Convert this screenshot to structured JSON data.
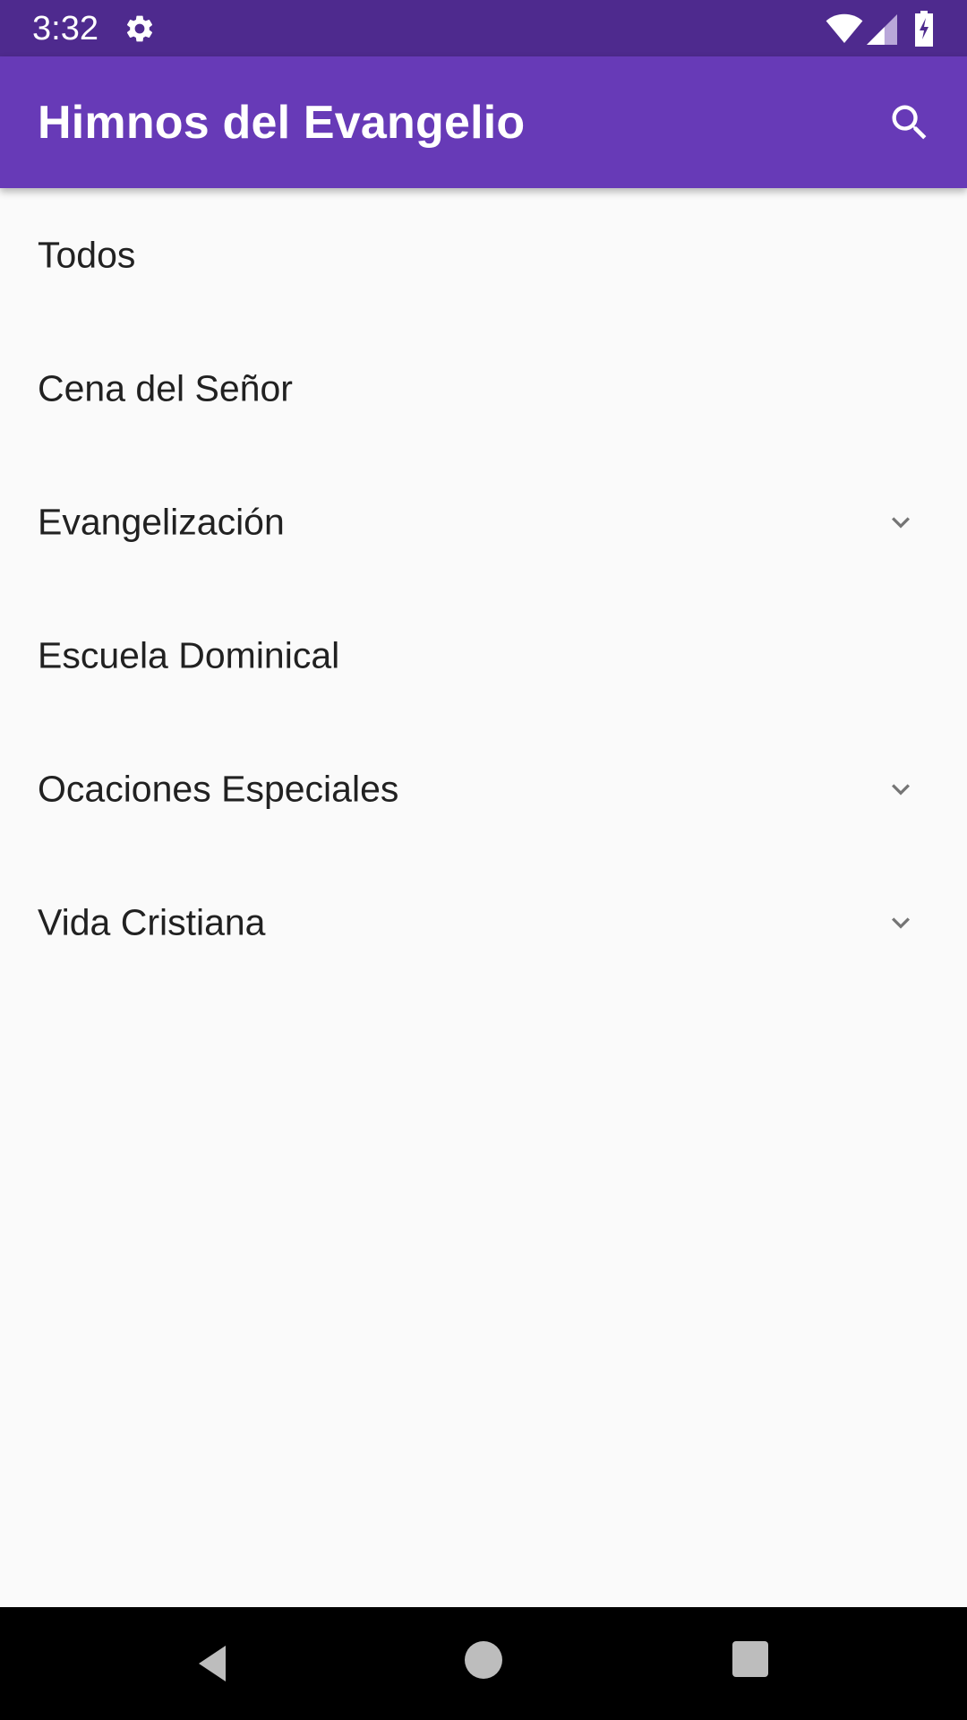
{
  "status_bar": {
    "time": "3:32",
    "icons": [
      "gear-icon",
      "wifi-icon",
      "signal-icon",
      "battery-icon"
    ]
  },
  "app_bar": {
    "title": "Himnos del Evangelio",
    "search_icon": "search-icon",
    "background": "#673ab7"
  },
  "categories": [
    {
      "label": "Todos",
      "expandable": false
    },
    {
      "label": "Cena del Señor",
      "expandable": false
    },
    {
      "label": "Evangelización",
      "expandable": true
    },
    {
      "label": "Escuela Dominical",
      "expandable": false
    },
    {
      "label": "Ocaciones Especiales",
      "expandable": true
    },
    {
      "label": "Vida Cristiana",
      "expandable": true
    }
  ],
  "nav_bar": {
    "icons": [
      "back-icon",
      "home-icon",
      "recents-icon"
    ]
  },
  "colors": {
    "status_bar": "#4e2a8e",
    "accent": "#673ab7",
    "background": "#fafafa",
    "text": "#212121"
  }
}
